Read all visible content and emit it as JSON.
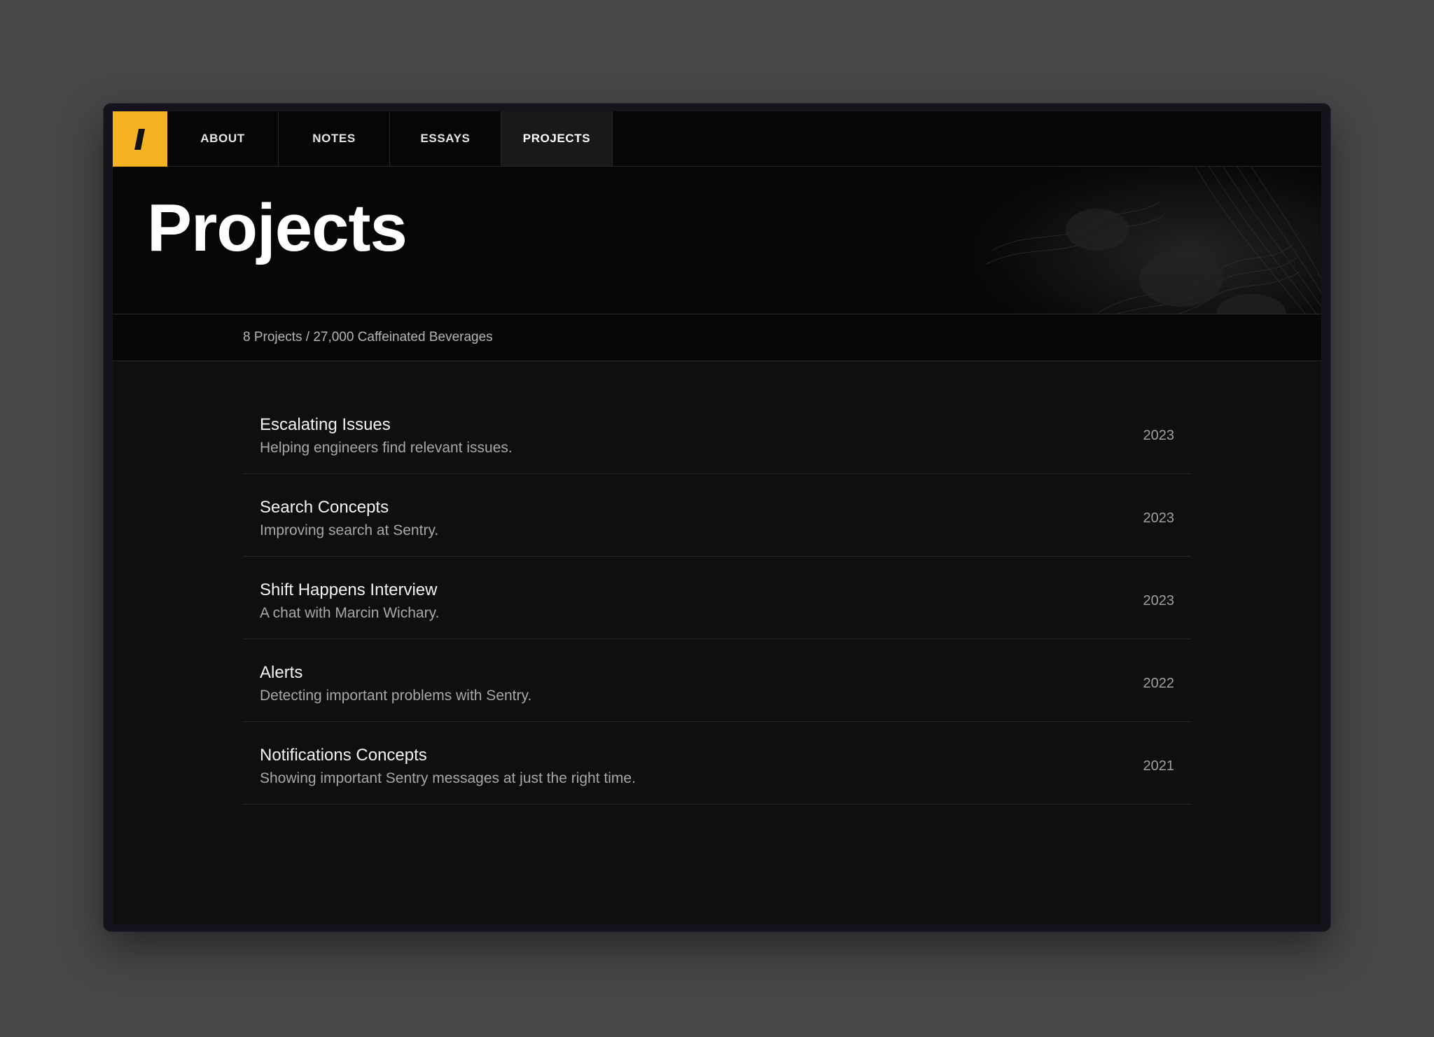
{
  "nav": {
    "logo_glyph": "/",
    "logo_color": "#f6b321",
    "items": [
      {
        "label": "ABOUT",
        "active": false
      },
      {
        "label": "NOTES",
        "active": false
      },
      {
        "label": "ESSAYS",
        "active": false
      },
      {
        "label": "PROJECTS",
        "active": true
      }
    ]
  },
  "hero": {
    "title": "Projects",
    "stats": "8 Projects / 27,000 Caffeinated Beverages"
  },
  "projects": [
    {
      "title": "Escalating Issues",
      "description": "Helping engineers find relevant issues.",
      "year": "2023"
    },
    {
      "title": "Search Concepts",
      "description": "Improving search at Sentry.",
      "year": "2023"
    },
    {
      "title": "Shift Happens Interview",
      "description": "A chat with Marcin Wichary.",
      "year": "2023"
    },
    {
      "title": "Alerts",
      "description": "Detecting important problems with Sentry.",
      "year": "2022"
    },
    {
      "title": "Notifications Concepts",
      "description": "Showing important Sentry messages at just the right time.",
      "year": "2021"
    }
  ],
  "colors": {
    "background": "#0f0f0f",
    "accent": "#f6b321",
    "text": "#ffffff",
    "muted": "#a8a8a8"
  }
}
